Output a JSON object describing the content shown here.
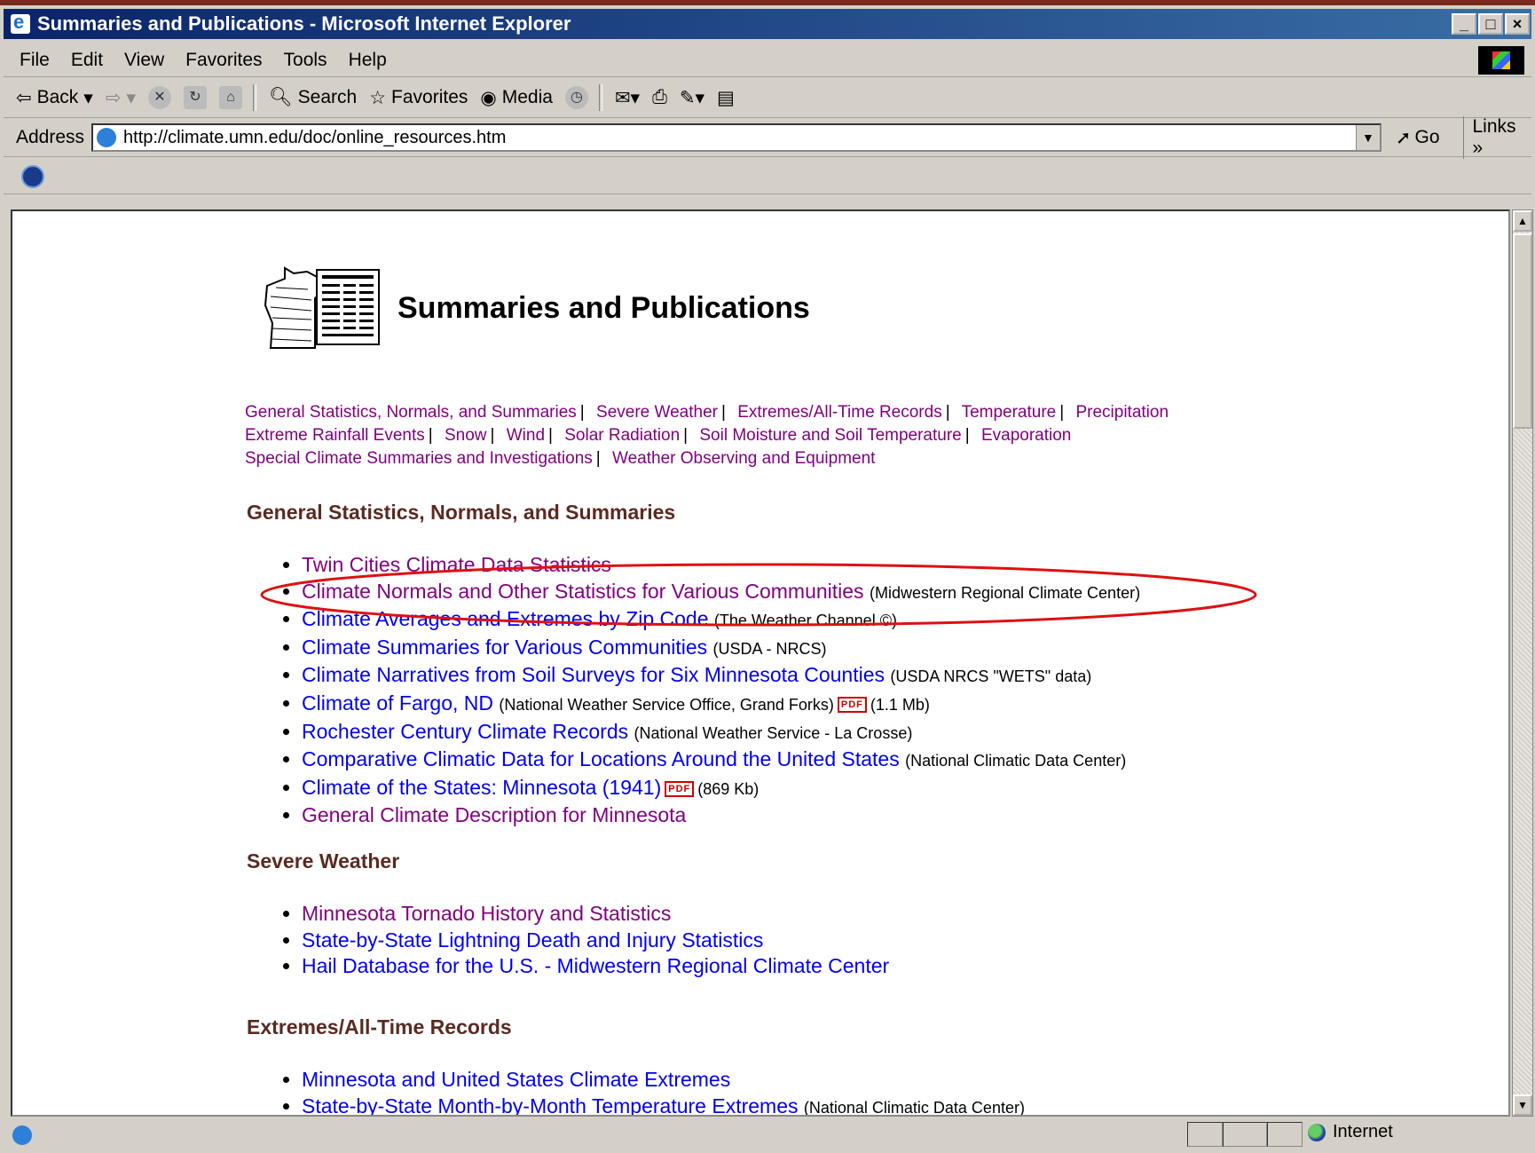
{
  "window": {
    "title": "Summaries and Publications - Microsoft Internet Explorer"
  },
  "menu": [
    "File",
    "Edit",
    "View",
    "Favorites",
    "Tools",
    "Help"
  ],
  "toolbar": {
    "back": "Back",
    "search": "Search",
    "favorites": "Favorites",
    "media": "Media"
  },
  "address": {
    "label": "Address",
    "url": "http://climate.umn.edu/doc/online_resources.htm",
    "go": "Go",
    "links": "Links"
  },
  "page": {
    "title": "Summaries and Publications",
    "nav": [
      [
        "General Statistics, Normals, and Summaries",
        "Severe Weather",
        "Extremes/All-Time Records",
        "Temperature",
        "Precipitation"
      ],
      [
        "Extreme Rainfall Events",
        "Snow",
        "Wind",
        "Solar Radiation",
        "Soil Moisture and Soil Temperature",
        "Evaporation"
      ],
      [
        "Special Climate Summaries and Investigations",
        "Weather Observing and Equipment"
      ]
    ],
    "sections": [
      {
        "heading": "General Statistics, Normals, and Summaries",
        "items": [
          {
            "text": "Twin Cities Climate Data Statistics",
            "visited": true
          },
          {
            "text": "Climate Normals and Other Statistics for Various Communities",
            "source": "(Midwestern Regional Climate Center)",
            "visited": true
          },
          {
            "text": "Climate Averages and Extremes by Zip Code",
            "source": "(The Weather Channel ©)"
          },
          {
            "text": "Climate Summaries for Various Communities",
            "source": "(USDA - NRCS)"
          },
          {
            "text": "Climate Narratives from Soil Surveys for Six Minnesota Counties",
            "source": "(USDA NRCS \"WETS\" data)"
          },
          {
            "text": "Climate of Fargo, ND",
            "source": "(National Weather Service Office, Grand Forks)",
            "pdf": true,
            "size": "(1.1 Mb)"
          },
          {
            "text": "Rochester Century Climate Records",
            "source": "(National Weather Service - La Crosse)"
          },
          {
            "text": "Comparative Climatic Data for Locations Around the United States",
            "source": "(National Climatic Data Center)"
          },
          {
            "text": "Climate of the States: Minnesota (1941)",
            "pdf": true,
            "size": "(869 Kb)"
          },
          {
            "text": "General Climate Description for Minnesota",
            "visited": true
          }
        ]
      },
      {
        "heading": "Severe Weather",
        "items": [
          {
            "text": "Minnesota Tornado History and Statistics",
            "visited": true
          },
          {
            "text": "State-by-State Lightning Death and Injury Statistics"
          },
          {
            "text": "Hail Database for the U.S. - Midwestern Regional Climate Center"
          }
        ]
      },
      {
        "heading": "Extremes/All-Time Records",
        "items": [
          {
            "text": "Minnesota and United States Climate Extremes"
          },
          {
            "text": "State-by-State Month-by-Month Temperature Extremes",
            "source": "(National Climatic Data Center)"
          }
        ]
      }
    ],
    "pdf_label": "PDF"
  },
  "status": {
    "zone": "Internet"
  },
  "colors": {
    "visited": "#800080",
    "link": "#0000ee",
    "heading": "#5a2a22",
    "highlight": "#dd1111"
  }
}
